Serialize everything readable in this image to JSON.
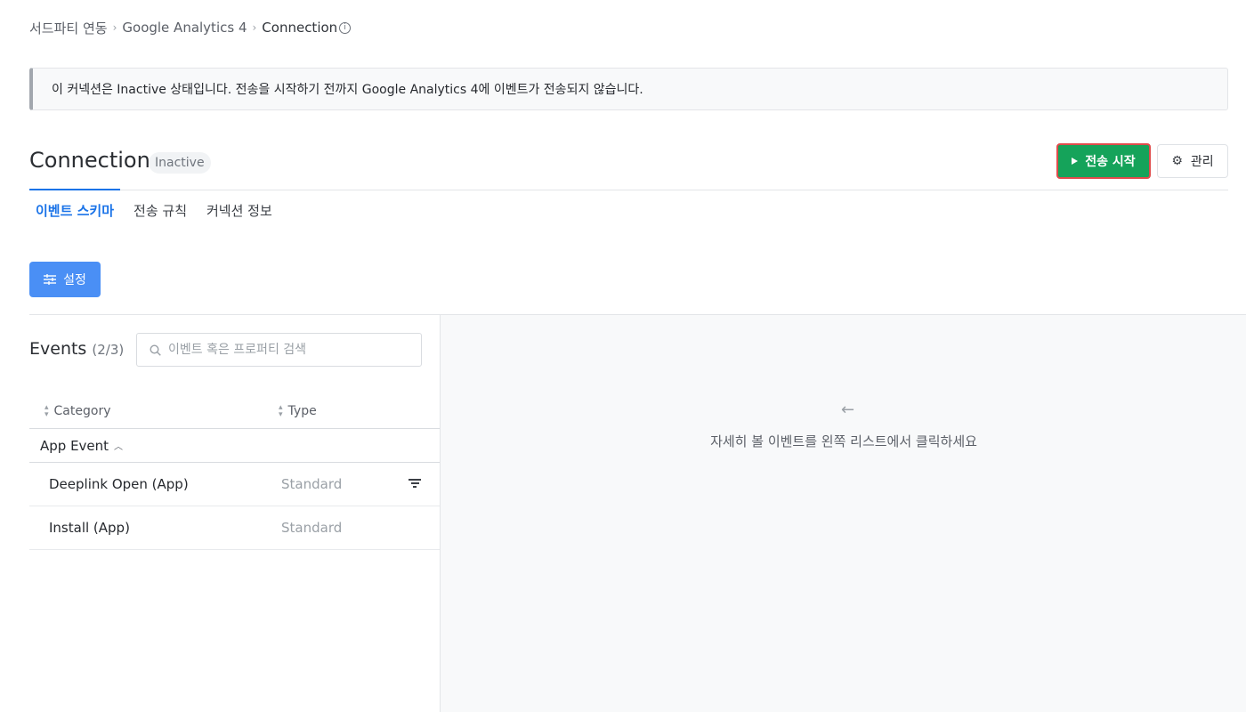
{
  "breadcrumb": {
    "items": [
      "서드파티 연동",
      "Google Analytics 4",
      "Connection"
    ],
    "separator": ">",
    "info_icon": "info-circle-icon"
  },
  "banner": {
    "message": "이 커넥션은 Inactive 상태입니다. 전송을 시작하기 전까지 Google Analytics 4에 이벤트가 전송되지 않습니다."
  },
  "header": {
    "title": "Connection",
    "status": "Inactive",
    "start_button": "전송 시작",
    "manage_button": "관리",
    "colors": {
      "start": "#15a35a",
      "start_border": "#e04b4b"
    }
  },
  "tabs": [
    {
      "label": "이벤트 스키마",
      "active": true
    },
    {
      "label": "전송 규칙",
      "active": false
    },
    {
      "label": "커넥션 정보",
      "active": false
    }
  ],
  "settings_button": "설정",
  "events": {
    "title": "Events",
    "count": "(2/3)",
    "search_placeholder": "이벤트 혹은 프로퍼티 검색",
    "columns": [
      "Category",
      "Type"
    ],
    "group": "App Event",
    "rows": [
      {
        "name": "Deeplink Open (App)",
        "type": "Standard",
        "has_filter": true
      },
      {
        "name": "Install (App)",
        "type": "Standard",
        "has_filter": false
      }
    ]
  },
  "detail": {
    "hint": "자세히 볼 이벤트를 왼쪽 리스트에서 클릭하세요",
    "arrow_icon": "arrow-left-icon"
  }
}
